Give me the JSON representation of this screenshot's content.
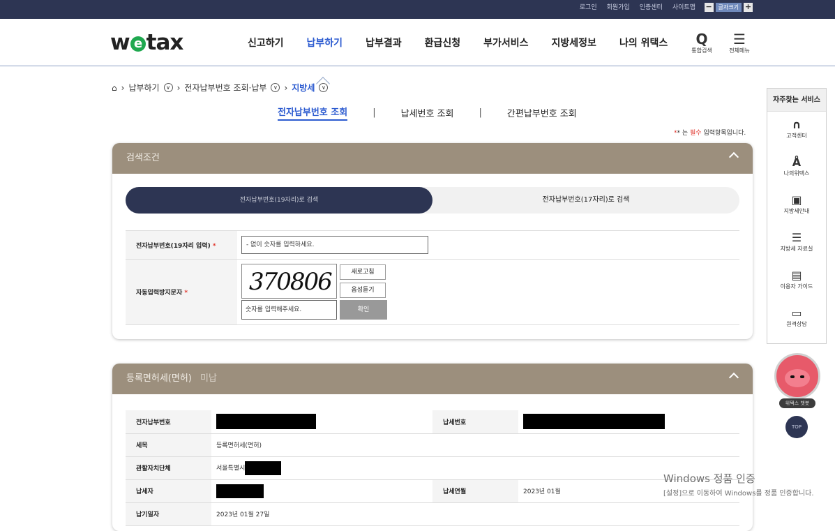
{
  "topbar": {
    "links": [
      "로그인",
      "회원가입",
      "인증센터",
      "사이트맵"
    ],
    "font_minus": "−",
    "font_label": "글자크기",
    "font_plus": "+"
  },
  "gnb": {
    "logo_prefix": "w",
    "logo_e": "e",
    "logo_suffix": "tax",
    "menu": [
      "신고하기",
      "납부하기",
      "납부결과",
      "환급신청",
      "부가서비스",
      "지방세정보",
      "나의 위택스"
    ],
    "active_index": 1,
    "search_label": "통합검색",
    "allmenu_label": "전체메뉴"
  },
  "breadcrumb": {
    "items": [
      "납부하기",
      "전자납부번호 조회·납부"
    ],
    "current": "지방세"
  },
  "subtabs": [
    "전자납부번호 조회",
    "납세번호 조회",
    "간편납부번호 조회"
  ],
  "required_note": {
    "prefix": "* 는 ",
    "highlight": "필수",
    "suffix": " 입력항목입니다."
  },
  "search_panel": {
    "title": "검색조건",
    "toggle_on": "전자납부번호(19자리)로 검색",
    "toggle_off": "전자납부번호(17자리)로 검색",
    "field1_label": "전자납부번호(19자리 입력)",
    "field1_placeholder": "- 없이 숫자를 입력하세요.",
    "field2_label": "자동입력방지문자",
    "captcha_text": "370806",
    "refresh_button": "새로고침",
    "audio_button": "음성듣기",
    "captcha_placeholder": "숫자를 입력해주세요.",
    "confirm_button": "확인"
  },
  "result_panel": {
    "title": "등록면허세(면허)",
    "title_suffix": "미납",
    "rows": [
      {
        "label": "전자납부번호",
        "value": "",
        "label2": "납세번호",
        "value2": ""
      },
      {
        "label": "세목",
        "value": "등록면허세(면허)"
      },
      {
        "label": "관할자치단체",
        "value": "서울특별시"
      },
      {
        "label": "납세자",
        "value": "",
        "label2": "납세연월",
        "value2": "2023년 01월"
      },
      {
        "label": "납기일자",
        "value": "2023년 01월 27일"
      }
    ]
  },
  "quick_menu": {
    "title": "자주찾는 서비스",
    "items": [
      {
        "icon": "headset-icon",
        "glyph": "∩",
        "label": "고객센터"
      },
      {
        "icon": "person-icon",
        "glyph": "Å",
        "label": "나의위택스"
      },
      {
        "icon": "robot-icon",
        "glyph": "▣",
        "label": "지방세안내"
      },
      {
        "icon": "list-icon",
        "glyph": "☰",
        "label": "지방세 자료실"
      },
      {
        "icon": "chat-icon",
        "glyph": "▤",
        "label": "이용자 가이드"
      },
      {
        "icon": "monitor-icon",
        "glyph": "▭",
        "label": "원격상담"
      }
    ]
  },
  "mascot_label": "위택스 챗봇",
  "top_button": "TOP",
  "watermark": {
    "line1": "Windows 정품 인증",
    "line2": "[설정]으로 이동하여 Windows를 정품 인증합니다."
  },
  "colors": {
    "navy": "#2d3553",
    "accent_blue": "#2c5bd0",
    "panel_head": "#9c8f7d",
    "required_red": "#e0342b"
  }
}
